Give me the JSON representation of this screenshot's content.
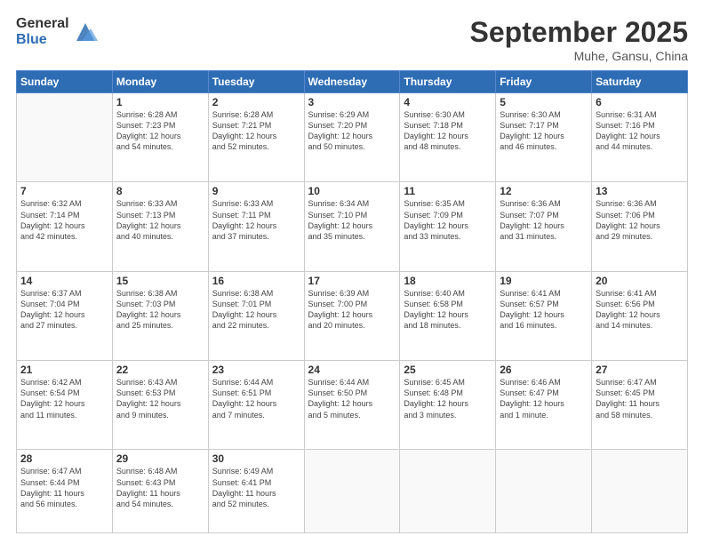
{
  "header": {
    "logo_general": "General",
    "logo_blue": "Blue",
    "title": "September 2025",
    "location": "Muhe, Gansu, China"
  },
  "weekdays": [
    "Sunday",
    "Monday",
    "Tuesday",
    "Wednesday",
    "Thursday",
    "Friday",
    "Saturday"
  ],
  "weeks": [
    [
      {
        "day": "",
        "info": ""
      },
      {
        "day": "1",
        "info": "Sunrise: 6:28 AM\nSunset: 7:23 PM\nDaylight: 12 hours\nand 54 minutes."
      },
      {
        "day": "2",
        "info": "Sunrise: 6:28 AM\nSunset: 7:21 PM\nDaylight: 12 hours\nand 52 minutes."
      },
      {
        "day": "3",
        "info": "Sunrise: 6:29 AM\nSunset: 7:20 PM\nDaylight: 12 hours\nand 50 minutes."
      },
      {
        "day": "4",
        "info": "Sunrise: 6:30 AM\nSunset: 7:18 PM\nDaylight: 12 hours\nand 48 minutes."
      },
      {
        "day": "5",
        "info": "Sunrise: 6:30 AM\nSunset: 7:17 PM\nDaylight: 12 hours\nand 46 minutes."
      },
      {
        "day": "6",
        "info": "Sunrise: 6:31 AM\nSunset: 7:16 PM\nDaylight: 12 hours\nand 44 minutes."
      }
    ],
    [
      {
        "day": "7",
        "info": "Sunrise: 6:32 AM\nSunset: 7:14 PM\nDaylight: 12 hours\nand 42 minutes."
      },
      {
        "day": "8",
        "info": "Sunrise: 6:33 AM\nSunset: 7:13 PM\nDaylight: 12 hours\nand 40 minutes."
      },
      {
        "day": "9",
        "info": "Sunrise: 6:33 AM\nSunset: 7:11 PM\nDaylight: 12 hours\nand 37 minutes."
      },
      {
        "day": "10",
        "info": "Sunrise: 6:34 AM\nSunset: 7:10 PM\nDaylight: 12 hours\nand 35 minutes."
      },
      {
        "day": "11",
        "info": "Sunrise: 6:35 AM\nSunset: 7:09 PM\nDaylight: 12 hours\nand 33 minutes."
      },
      {
        "day": "12",
        "info": "Sunrise: 6:36 AM\nSunset: 7:07 PM\nDaylight: 12 hours\nand 31 minutes."
      },
      {
        "day": "13",
        "info": "Sunrise: 6:36 AM\nSunset: 7:06 PM\nDaylight: 12 hours\nand 29 minutes."
      }
    ],
    [
      {
        "day": "14",
        "info": "Sunrise: 6:37 AM\nSunset: 7:04 PM\nDaylight: 12 hours\nand 27 minutes."
      },
      {
        "day": "15",
        "info": "Sunrise: 6:38 AM\nSunset: 7:03 PM\nDaylight: 12 hours\nand 25 minutes."
      },
      {
        "day": "16",
        "info": "Sunrise: 6:38 AM\nSunset: 7:01 PM\nDaylight: 12 hours\nand 22 minutes."
      },
      {
        "day": "17",
        "info": "Sunrise: 6:39 AM\nSunset: 7:00 PM\nDaylight: 12 hours\nand 20 minutes."
      },
      {
        "day": "18",
        "info": "Sunrise: 6:40 AM\nSunset: 6:58 PM\nDaylight: 12 hours\nand 18 minutes."
      },
      {
        "day": "19",
        "info": "Sunrise: 6:41 AM\nSunset: 6:57 PM\nDaylight: 12 hours\nand 16 minutes."
      },
      {
        "day": "20",
        "info": "Sunrise: 6:41 AM\nSunset: 6:56 PM\nDaylight: 12 hours\nand 14 minutes."
      }
    ],
    [
      {
        "day": "21",
        "info": "Sunrise: 6:42 AM\nSunset: 6:54 PM\nDaylight: 12 hours\nand 11 minutes."
      },
      {
        "day": "22",
        "info": "Sunrise: 6:43 AM\nSunset: 6:53 PM\nDaylight: 12 hours\nand 9 minutes."
      },
      {
        "day": "23",
        "info": "Sunrise: 6:44 AM\nSunset: 6:51 PM\nDaylight: 12 hours\nand 7 minutes."
      },
      {
        "day": "24",
        "info": "Sunrise: 6:44 AM\nSunset: 6:50 PM\nDaylight: 12 hours\nand 5 minutes."
      },
      {
        "day": "25",
        "info": "Sunrise: 6:45 AM\nSunset: 6:48 PM\nDaylight: 12 hours\nand 3 minutes."
      },
      {
        "day": "26",
        "info": "Sunrise: 6:46 AM\nSunset: 6:47 PM\nDaylight: 12 hours\nand 1 minute."
      },
      {
        "day": "27",
        "info": "Sunrise: 6:47 AM\nSunset: 6:45 PM\nDaylight: 11 hours\nand 58 minutes."
      }
    ],
    [
      {
        "day": "28",
        "info": "Sunrise: 6:47 AM\nSunset: 6:44 PM\nDaylight: 11 hours\nand 56 minutes."
      },
      {
        "day": "29",
        "info": "Sunrise: 6:48 AM\nSunset: 6:43 PM\nDaylight: 11 hours\nand 54 minutes."
      },
      {
        "day": "30",
        "info": "Sunrise: 6:49 AM\nSunset: 6:41 PM\nDaylight: 11 hours\nand 52 minutes."
      },
      {
        "day": "",
        "info": ""
      },
      {
        "day": "",
        "info": ""
      },
      {
        "day": "",
        "info": ""
      },
      {
        "day": "",
        "info": ""
      }
    ]
  ]
}
